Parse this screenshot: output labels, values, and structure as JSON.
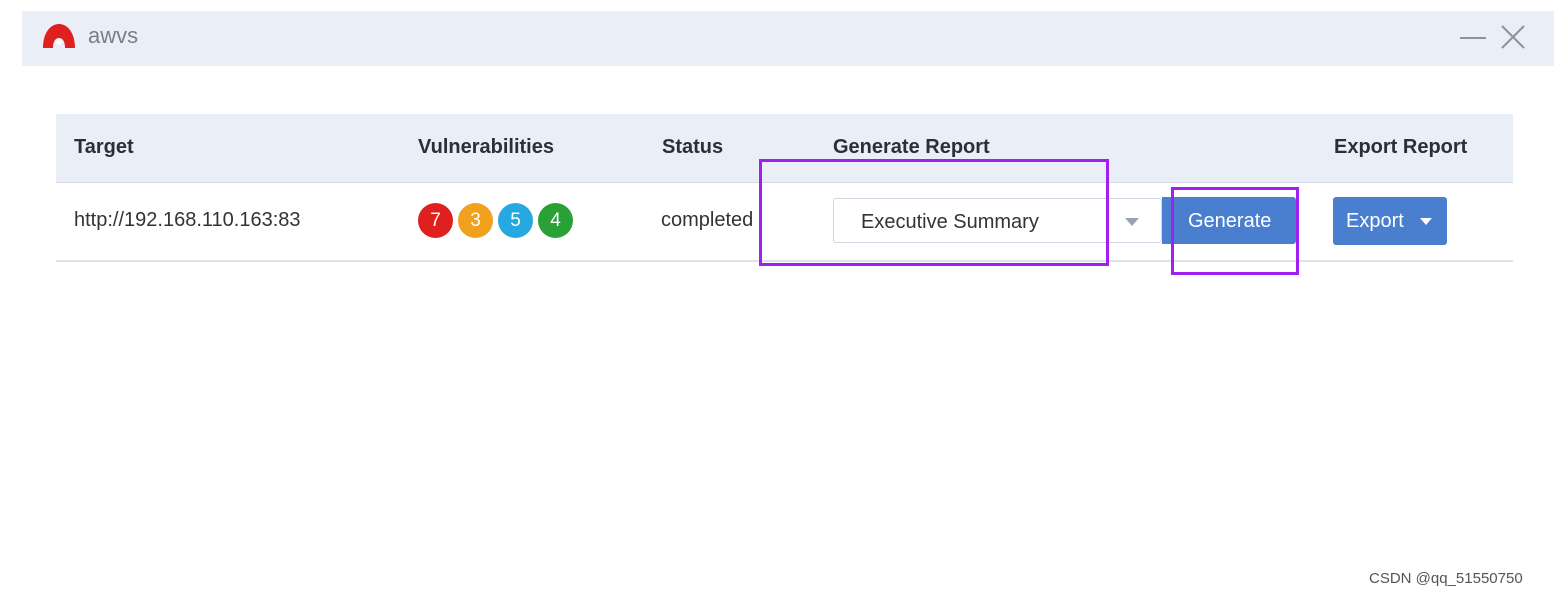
{
  "window": {
    "title": "awvs",
    "icons": {
      "logo": "awvs-logo-icon",
      "minimize": "minimize-icon",
      "close": "close-icon"
    }
  },
  "table": {
    "headers": {
      "target": "Target",
      "vulnerabilities": "Vulnerabilities",
      "status": "Status",
      "generate_report": "Generate Report",
      "export_report": "Export Report"
    },
    "rows": [
      {
        "target": "http://192.168.110.163:83",
        "vulnerabilities": {
          "high": "7",
          "medium": "3",
          "low": "5",
          "info": "4"
        },
        "status": "completed",
        "report_template": "Executive Summary",
        "generate_label": "Generate",
        "export_label": "Export"
      }
    ]
  },
  "colors": {
    "high": "#e0201f",
    "medium": "#f0a21e",
    "low": "#26a9e0",
    "info": "#2aa136",
    "primary_button": "#4a7fd0",
    "highlight": "#a020f0"
  },
  "watermark": "CSDN @qq_51550750"
}
